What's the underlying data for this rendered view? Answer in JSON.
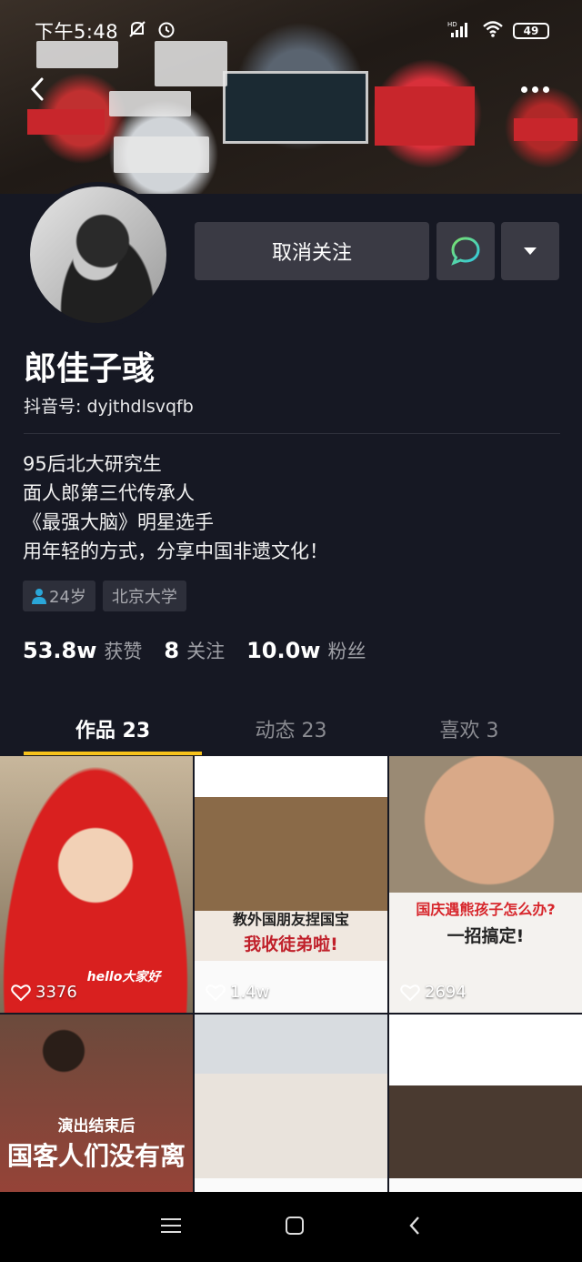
{
  "status_bar": {
    "time": "下午5:48",
    "battery": "49",
    "network": "HD"
  },
  "cover": {
    "icons": {
      "back": "back-icon",
      "more": "more-icon"
    }
  },
  "profile": {
    "name": "郎佳子彧",
    "douyin_id": "抖音号: dyjthdlsvqfb",
    "buttons": {
      "unfollow": "取消关注"
    },
    "bio": [
      "95后北大研究生",
      "面人郎第三代传承人",
      "《最强大脑》明星选手",
      "用年轻的方式，分享中国非遗文化！"
    ],
    "tags": [
      {
        "icon": "person-icon",
        "label": "24岁"
      },
      {
        "label": "北京大学"
      }
    ],
    "stats": [
      {
        "value": "53.8w",
        "label": "获赞"
      },
      {
        "value": "8",
        "label": "关注"
      },
      {
        "value": "10.0w",
        "label": "粉丝"
      }
    ]
  },
  "tabs": [
    "作品 23",
    "动态 23",
    "喜欢 3"
  ],
  "videos": [
    {
      "likes": "3376",
      "caption": "hello大家好"
    },
    {
      "likes": "1.4w",
      "caption": "教外国朋友捏国宝",
      "caption2": "我收徒弟啦!"
    },
    {
      "likes": "2694",
      "caption": "国庆遇熊孩子怎么办?",
      "caption2": "一招搞定!"
    },
    {
      "caption": "演出结束后",
      "caption2": "国客人们没有离"
    },
    {},
    {}
  ],
  "colors": {
    "accent": "#f7c21b",
    "background": "#161823",
    "button": "#3a3a44",
    "chat_icon": "#4ee0c0"
  }
}
